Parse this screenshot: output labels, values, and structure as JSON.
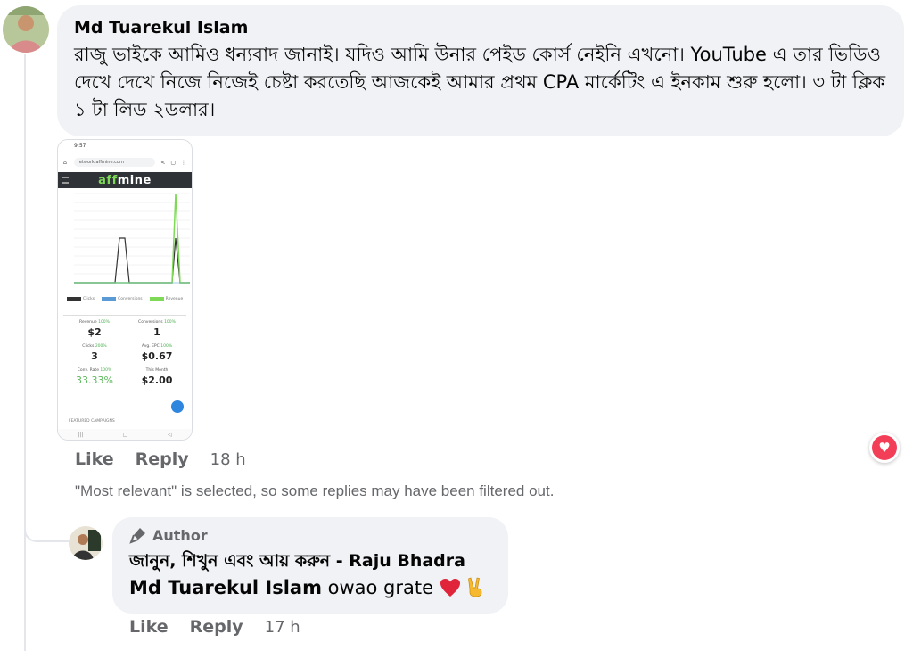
{
  "comment": {
    "author": "Md Tuarekul Islam",
    "text": "রাজু ভাইকে আমিও ধন্যবাদ জানাই। যদিও আমি উনার পেইড কোর্স নেইনি এখনো। YouTube এ তার ভিডিও দেখে দেখে নিজে নিজেই চেষ্টা করতেছি আজকেই আমার প্রথম CPA মার্কেটিং এ ইনকাম শুরু হলো। ৩ টা ক্লিক ১ টা লিড ২ডলার।",
    "actions": {
      "like": "Like",
      "reply": "Reply",
      "time": "18 h"
    },
    "reaction_icon": "heart-reaction-icon"
  },
  "attachment": {
    "status_time": "9:57",
    "url": "etwork.affmine.com",
    "logo_prefix": "aff",
    "logo_suffix": "mine",
    "legend": [
      "Clicks",
      "Conversions",
      "Revenue"
    ],
    "stats": [
      {
        "label": "Revenue",
        "delta": "100%",
        "value": "$2"
      },
      {
        "label": "Conversions",
        "delta": "100%",
        "value": "1"
      },
      {
        "label": "Clicks",
        "delta": "200%",
        "value": "3"
      },
      {
        "label": "Avg. EPC",
        "delta": "100%",
        "value": "$0.67"
      },
      {
        "label": "Conv. Rate",
        "delta": "100%",
        "value": "33.33%"
      },
      {
        "label": "This Month",
        "delta": "",
        "value": "$2.00"
      }
    ],
    "footer": "FEATURED CAMPAIGNS",
    "colors": {
      "clicks": "#333333",
      "conversions": "#5b9bd5",
      "revenue": "#7ed957"
    }
  },
  "filter_note": "\"Most relevant\" is selected, so some replies may have been filtered out.",
  "reply": {
    "badge": "Author",
    "page_name": "জানুন, শিখুন এবং আয় করুন - Raju Bhadra",
    "mention": "Md Tuarekul Islam",
    "text": " owao grate",
    "actions": {
      "like": "Like",
      "reply": "Reply",
      "time": "17 h"
    }
  }
}
